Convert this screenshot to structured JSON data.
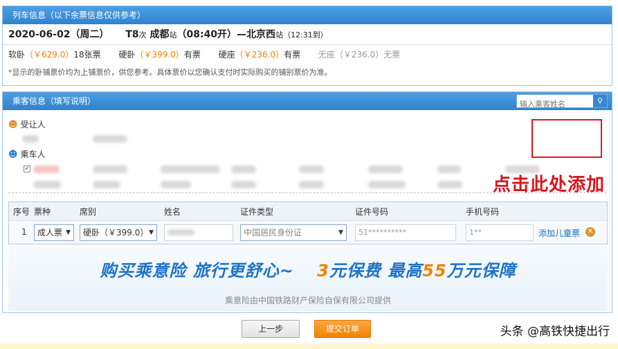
{
  "train_info": {
    "header": "列车信息（以下余票信息仅供参考）",
    "date": "2020-06-02（周二）",
    "train_no": "T8",
    "train_suffix": "次",
    "from_station": "成都",
    "station_suffix": "站",
    "depart": "（08:40开）",
    "dash": "—",
    "to_station": "北京西",
    "arrive": "（12:31到）",
    "seats": [
      {
        "type": "软卧",
        "price": "（￥629.0）",
        "avail": "18张票"
      },
      {
        "type": "硬卧",
        "price": "（￥399.0）",
        "avail": "有票"
      },
      {
        "type": "硬座",
        "price": "（￥236.0）",
        "avail": "有票"
      },
      {
        "type": "无座",
        "price": "（￥236.0）",
        "avail": "无票"
      }
    ],
    "notice": "*显示的卧铺票价均为上铺票价，供您参考。具体票价以您确认支付时实际购买的铺别票价为准。"
  },
  "passenger_info": {
    "header": "乘客信息（填写说明）",
    "search_placeholder": "输入乘客姓名",
    "assignee_label": "受让人",
    "passenger_label": "乘车人",
    "annotation": "点击此处添加",
    "table": {
      "headers": [
        "序号",
        "票种",
        "席别",
        "姓名",
        "证件类型",
        "证件号码",
        "手机号码"
      ],
      "row": {
        "index": "1",
        "ticket_type": "成人票",
        "seat_class": "硬卧（￥399.0）",
        "name": "",
        "id_type": "中国居民身份证",
        "id_number": "51**********",
        "phone": "1**",
        "add_child": "添加儿童票"
      }
    },
    "insurance": {
      "main_a": "购买乘意险  旅行更舒心~",
      "main_b1": "3",
      "main_b2": "元保费  最高",
      "main_b3": "55",
      "main_b4": "万元保障",
      "sub": "乘意险由中国铁路财产保险自保有限公司提供"
    }
  },
  "buttons": {
    "prev": "上一步",
    "submit": "提交订单"
  },
  "watermark": "头条 @高铁快捷出行",
  "colors": {
    "header_blue": "#2f83cf",
    "price_orange": "#f08300",
    "highlight_red": "#d41920"
  }
}
